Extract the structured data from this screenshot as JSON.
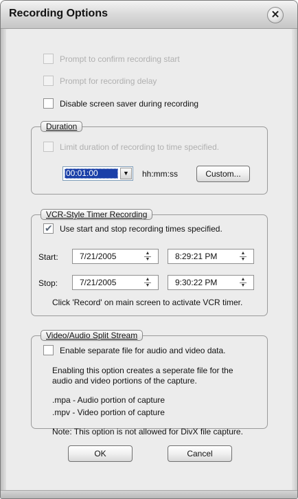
{
  "window": {
    "title": "Recording Options"
  },
  "options": [
    {
      "label": "Prompt to confirm recording start",
      "checked": false,
      "disabled": true
    },
    {
      "label": "Prompt for recording delay",
      "checked": false,
      "disabled": true
    },
    {
      "label": "Disable screen saver during recording",
      "checked": false,
      "disabled": false
    }
  ],
  "duration": {
    "title": "Duration",
    "limit_label": "Limit duration of recording to time specified.",
    "time_value": "00:01:00",
    "format_label": "hh:mm:ss",
    "custom_button": "Custom..."
  },
  "vcr": {
    "title": "VCR-Style Timer Recording",
    "use_label": "Use start and stop recording times specified.",
    "use_checked": true,
    "start_label": "Start:",
    "start_date": "7/21/2005",
    "start_time": "8:29:21 PM",
    "stop_label": "Stop:",
    "stop_date": "7/21/2005",
    "stop_time": "9:30:22 PM",
    "note": "Click 'Record' on main screen to activate VCR timer."
  },
  "split": {
    "title": "Video/Audio Split Stream",
    "enable_label": "Enable separate file for audio and video data.",
    "desc_line1": "Enabling this option creates a seperate file for the",
    "desc_line2": "audio and video portions of the capture.",
    "mpa_line": ".mpa - Audio portion of capture",
    "mpv_line": ".mpv - Video portion of capture",
    "note": "Note: This option is not allowed for DivX file capture."
  },
  "buttons": {
    "ok": "OK",
    "cancel": "Cancel"
  },
  "icons": {
    "close": "close-icon",
    "dropdown": "chevron-down-icon",
    "spin": "spin-updown-icon",
    "check": "check-icon"
  },
  "colors": {
    "selection": "#1a3fa8",
    "panel": "#ececec",
    "disabled_text": "#b0b0b0"
  }
}
